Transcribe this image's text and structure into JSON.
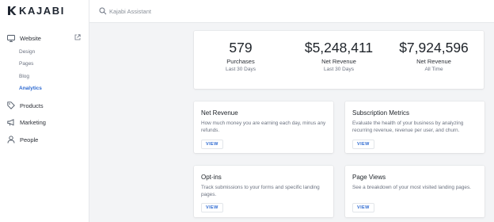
{
  "brand": {
    "name": "KAJABI"
  },
  "search": {
    "placeholder": "Kajabi Assistant",
    "value": ""
  },
  "sidebar": {
    "items": [
      {
        "label": "Website",
        "icon": "monitor-icon",
        "children": [
          "Design",
          "Pages",
          "Blog",
          "Analytics"
        ],
        "active_child": "Analytics"
      },
      {
        "label": "Products",
        "icon": "tag-icon"
      },
      {
        "label": "Marketing",
        "icon": "megaphone-icon"
      },
      {
        "label": "People",
        "icon": "person-icon"
      }
    ]
  },
  "stats": [
    {
      "value": "579",
      "label": "Purchases",
      "sub": "Last 30 Days"
    },
    {
      "value": "$5,248,411",
      "label": "Net Revenue",
      "sub": "Last 30 Days"
    },
    {
      "value": "$7,924,596",
      "label": "Net Revenue",
      "sub": "All Time"
    }
  ],
  "reports": [
    {
      "title": "Net Revenue",
      "description": "How much money you are earning each day, minus any refunds.",
      "button": "VIEW"
    },
    {
      "title": "Subscription Metrics",
      "description": "Evaluate the health of your business by analyzing recurring revenue, revenue per user, and churn.",
      "button": "VIEW"
    },
    {
      "title": "Opt-ins",
      "description": "Track submissions to your forms and specific landing pages.",
      "button": "VIEW"
    },
    {
      "title": "Page Views",
      "description": "See a breakdown of your most visited landing pages.",
      "button": "VIEW"
    }
  ],
  "colors": {
    "accent": "#2e6ad1",
    "background": "#f3f4f6",
    "text": "#2b2f36",
    "muted": "#6b7280"
  }
}
